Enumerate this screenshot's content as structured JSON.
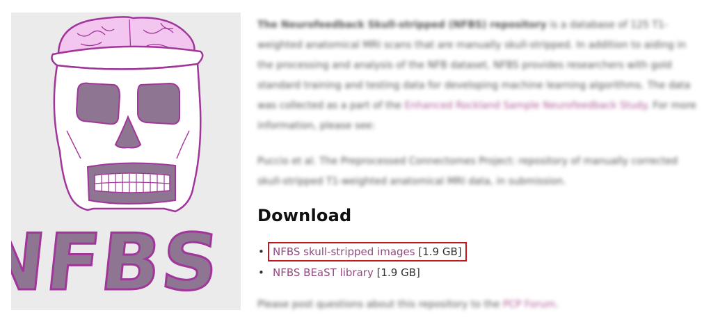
{
  "logo": {
    "text": "NFBS"
  },
  "intro": {
    "paragraph1_prefix": "The Neurofeedback Skull-stripped (NFBS) repository",
    "paragraph1_body": " is a database of 125 T1-weighted anatomical MRI scans that are manually skull-stripped. In addition to aiding in the processing and analysis of the NFB dataset, NFBS provides researchers with gold standard training and testing data for developing machine learning algorithms. The data was collected as a part of the ",
    "paragraph1_link": "Enhanced Rockland Sample Neurofeedback Study",
    "paragraph1_suffix": ". For more information, please see:",
    "paragraph2": "Puccio et al. The Preprocessed Connectomes Project: repository of manually corrected skull-stripped T1-weighted anatomical MRI data, in submission.",
    "paragraph3_prefix": "Please post questions about this repository to the ",
    "paragraph3_link": "PCP Forum",
    "paragraph3_suffix": "."
  },
  "download": {
    "heading": "Download",
    "items": [
      {
        "label": "NFBS skull-stripped images",
        "size": "[1.9 GB]",
        "highlighted": true
      },
      {
        "label": "NFBS BEaST library",
        "size": "[1.9 GB]",
        "highlighted": false
      }
    ]
  },
  "colors": {
    "link": "#8f4a7e",
    "highlight_border": "#c2181f",
    "brain": "#f3c6ef",
    "skull_fill": "#ffffff",
    "socket": "#8e7591",
    "outline": "#a0359a"
  }
}
